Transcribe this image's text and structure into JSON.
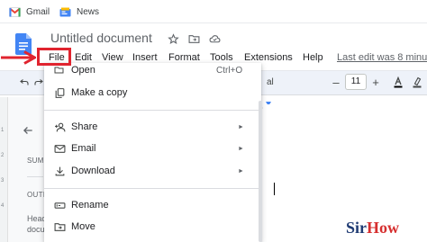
{
  "bookmarks": [
    {
      "label": "Gmail",
      "icon": "gmail-icon"
    },
    {
      "label": "News",
      "icon": "news-icon"
    }
  ],
  "document": {
    "title": "Untitled document",
    "icons": [
      "star-icon",
      "move-folder-icon",
      "cloud-status-icon"
    ]
  },
  "menubar": {
    "items": [
      "File",
      "Edit",
      "View",
      "Insert",
      "Format",
      "Tools",
      "Extensions",
      "Help"
    ],
    "last_edit": "Last edit was 8 minu"
  },
  "toolbar": {
    "font_fragment": "al",
    "font_size": "11"
  },
  "left_panel": {
    "summary_label": "SUM",
    "outline_label": "OUTI",
    "hint_line1": "Head",
    "hint_line2": "docu",
    "ruler_labels": [
      "1",
      "2",
      "3",
      "4"
    ]
  },
  "file_menu": {
    "items": [
      {
        "label": "Open",
        "icon": "folder-open-icon",
        "shortcut": "Ctrl+O",
        "submenu": false
      },
      {
        "label": "Make a copy",
        "icon": "copy-icon",
        "shortcut": "",
        "submenu": false
      },
      {
        "label": "Share",
        "icon": "share-person-icon",
        "shortcut": "",
        "submenu": true
      },
      {
        "label": "Email",
        "icon": "email-icon",
        "shortcut": "",
        "submenu": true
      },
      {
        "label": "Download",
        "icon": "download-icon",
        "shortcut": "",
        "submenu": true
      },
      {
        "label": "Rename",
        "icon": "rename-icon",
        "shortcut": "",
        "submenu": false
      },
      {
        "label": "Move",
        "icon": "move-icon",
        "shortcut": "",
        "submenu": false
      }
    ],
    "submenu_arrow": "►"
  },
  "annotation": {
    "highlight_color": "#e0242f"
  },
  "watermark": {
    "part1": "Sir",
    "part2": "How"
  },
  "colors": {
    "accent": "#1a73e8",
    "toolbar_bg": "#eef2f9",
    "annotation_red": "#e0242f"
  }
}
